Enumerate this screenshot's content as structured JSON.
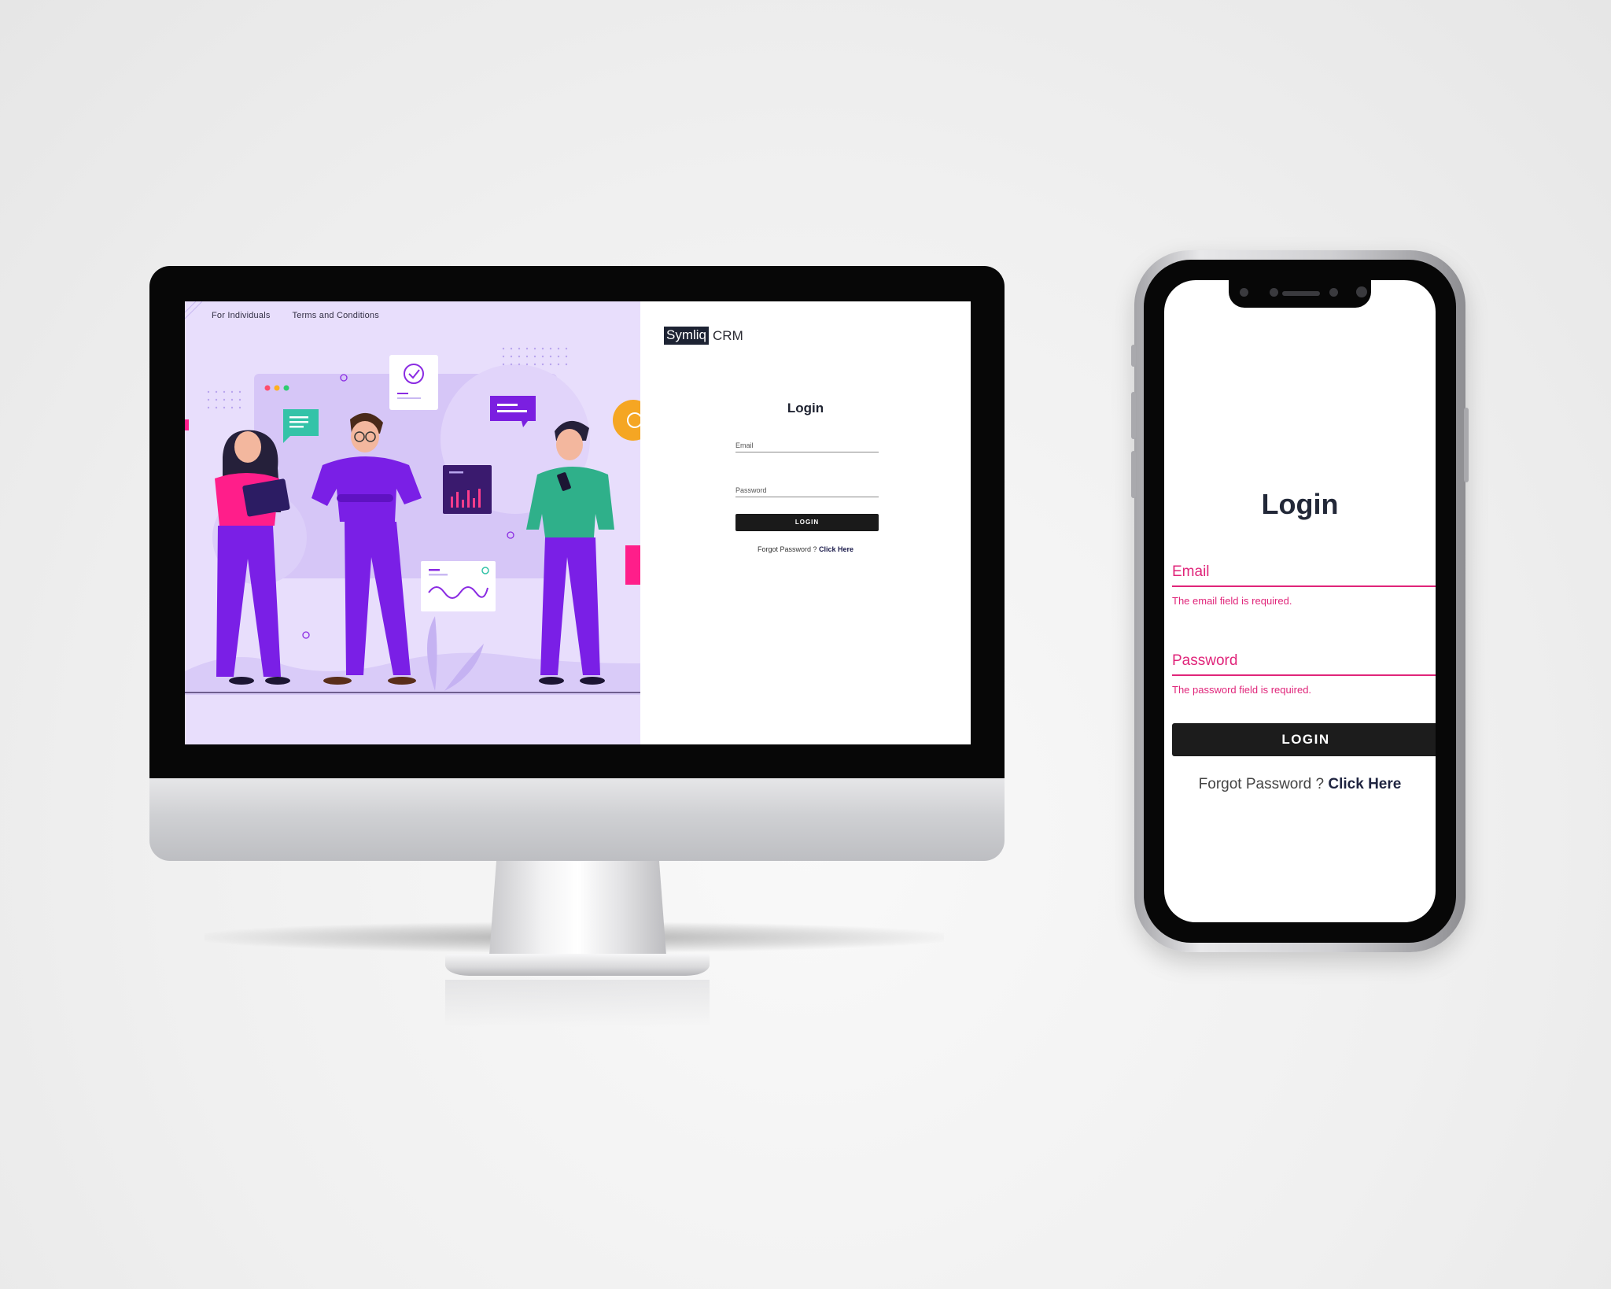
{
  "desktop": {
    "nav": [
      "For Individuals",
      "Terms and Conditions"
    ],
    "brand": {
      "box": "Symliq",
      "suffix": "CRM"
    },
    "login": {
      "title": "Login",
      "email_label": "Email",
      "password_label": "Password",
      "button": "LOGIN",
      "forgot_text": "Forgot Password ?",
      "forgot_link": "Click Here"
    }
  },
  "mobile": {
    "login": {
      "title": "Login",
      "email_label": "Email",
      "email_error": "The email field is required.",
      "password_label": "Password",
      "password_error": "The password field is required.",
      "button": "LOGIN",
      "forgot_text": "Forgot Password ?",
      "forgot_link": "Click Here"
    }
  },
  "colors": {
    "accent_error": "#e0257a",
    "illustration_bg": "#e8defc",
    "button_dark": "#1a1a1a"
  }
}
